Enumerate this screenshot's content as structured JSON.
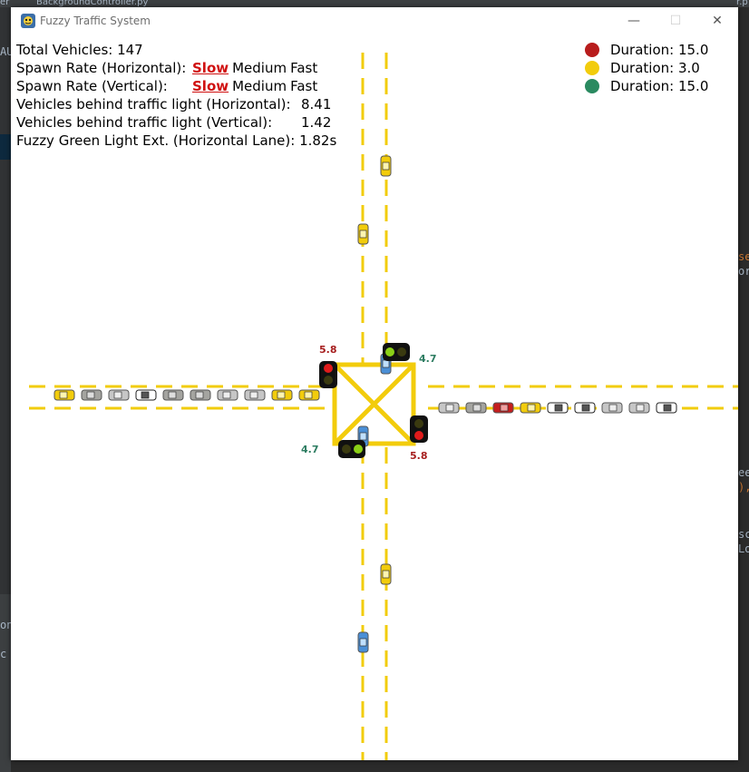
{
  "ide": {
    "tab_fragment_left": "er",
    "tab_file": "BackgroundController.py",
    "tab_fragment_right": "r.p",
    "snippets": [
      "AU",
      "se",
      "or",
      "ee",
      "),",
      "sc",
      "Lo",
      "on",
      "c"
    ]
  },
  "window": {
    "title": "Fuzzy Traffic System",
    "minimize_glyph": "—",
    "maximize_glyph": "☐",
    "close_glyph": "✕"
  },
  "stats": {
    "total_vehicles_label": "Total Vehicles:",
    "total_vehicles": "147",
    "spawn_h_label": "Spawn Rate (Horizontal):",
    "spawn_v_label": "Spawn Rate (Vertical):",
    "spawn_options": [
      "Slow",
      "Medium",
      "Fast"
    ],
    "spawn_h_selected": "Slow",
    "spawn_v_selected": "Slow",
    "behind_h_label": "Vehicles behind traffic light (Horizontal):",
    "behind_h": "8.41",
    "behind_v_label": "Vehicles behind traffic light (Vertical):",
    "behind_v": "1.42",
    "fuzzy_label": "Fuzzy Green Light Ext. (Horizontal Lane):",
    "fuzzy_value": "1.82s"
  },
  "legend": [
    {
      "color": "#b81c1c",
      "text": "Duration: 15.0"
    },
    {
      "color": "#f2cc0c",
      "text": "Duration: 3.0"
    },
    {
      "color": "#2a8a60",
      "text": "Duration: 15.0"
    }
  ],
  "light_timers": {
    "west": "5.8",
    "north": "4.7",
    "south": "4.7",
    "east": "5.8"
  },
  "colors": {
    "lane": "#f2cc0c",
    "red_timer": "#a61e1e",
    "green_timer": "#2e7d62",
    "selected_option": "#d01010"
  }
}
